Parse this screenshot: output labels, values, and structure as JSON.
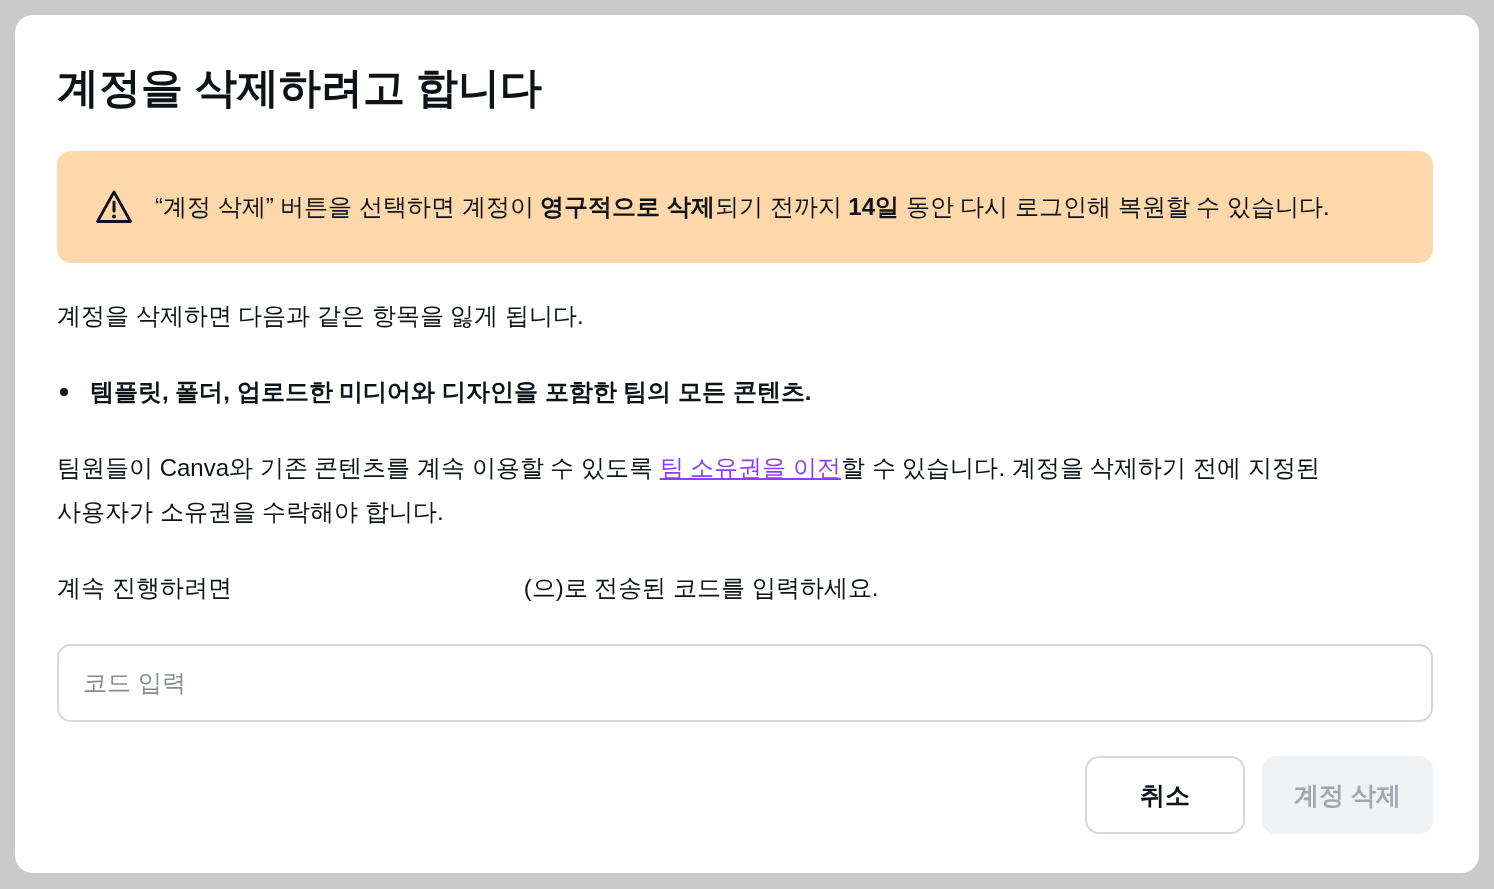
{
  "dialog": {
    "title": "계정을 삭제하려고 합니다",
    "alert": {
      "kind": "warning",
      "text": "“계정 삭제” 버튼을 선택하면 계정이 **영구적으로 삭제**되기 전까지 **14일** 동안 다시 로그인해 복원할 수 있습니다."
    },
    "intro": "계정을 삭제하면 다음과 같은 항목을 잃게 됩니다.",
    "loss_items": [
      {
        "text": "템플릿, 폴더, 업로드한 미디어와 디자인을 포함한 팀의 모든 콘텐츠."
      }
    ],
    "transfer_note": {
      "before": "팀원들이 Canva와 기존 콘텐츠를 계속 이용할 수 있도록 ",
      "link": "팀 소유권을 이전",
      "after": "할 수 있습니다. 계정을 삭제하기 전에 지정된 사용자가 소유권을 수락해야 합니다."
    },
    "code_prompt": {
      "before": "계속 진행하려면",
      "after": "(으)로 전송된 코드를 입력하세요."
    },
    "code_field": {
      "placeholder": "코드 입력"
    },
    "buttons": [
      {
        "label": "취소",
        "kind": "secondary",
        "disabled": false
      },
      {
        "label": "계정 삭제",
        "kind": "danger",
        "disabled": true
      }
    ]
  }
}
